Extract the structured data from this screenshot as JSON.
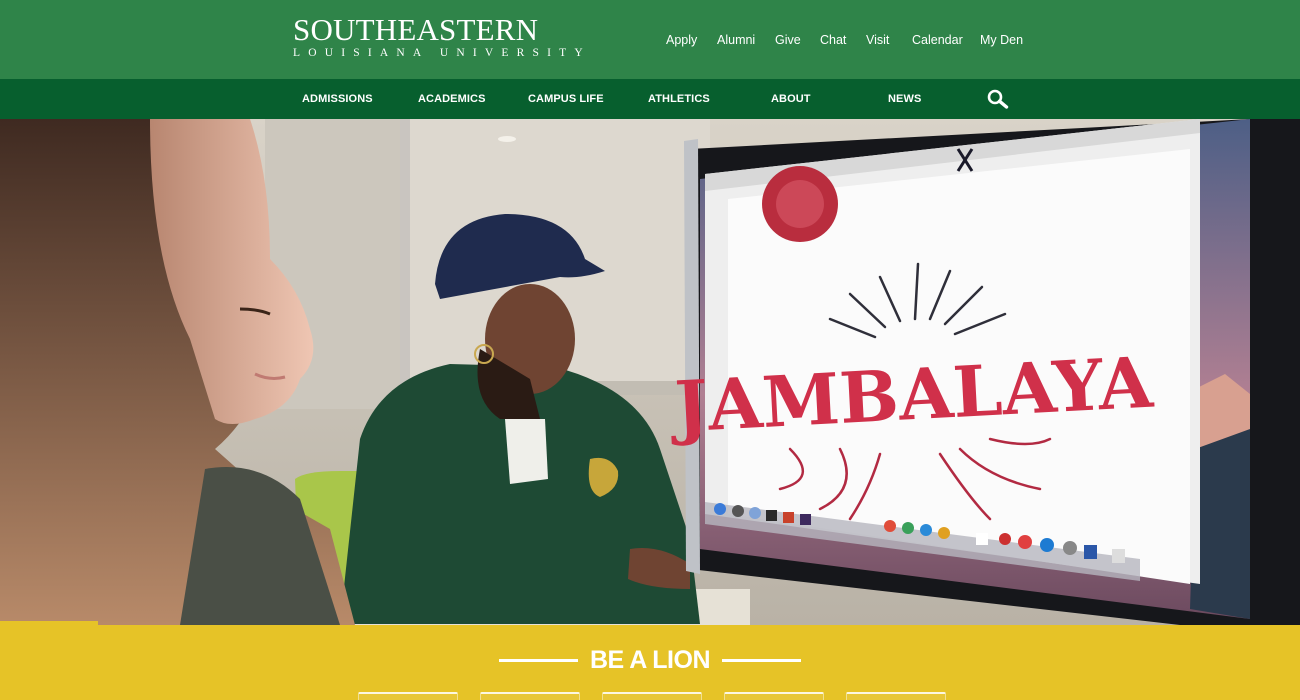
{
  "brand": {
    "name": "SOUTHEASTERN",
    "sub": "LOUISIANA UNIVERSITY"
  },
  "utility_nav": [
    {
      "label": "Apply",
      "name": "apply"
    },
    {
      "label": "Alumni",
      "name": "alumni"
    },
    {
      "label": "Give",
      "name": "give"
    },
    {
      "label": "Chat",
      "name": "chat"
    },
    {
      "label": "Visit",
      "name": "visit"
    },
    {
      "label": "Calendar",
      "name": "calendar"
    },
    {
      "label": "My Den",
      "name": "my-den"
    }
  ],
  "main_nav": [
    {
      "label": "ADMISSIONS",
      "name": "admissions"
    },
    {
      "label": "ACADEMICS",
      "name": "academics"
    },
    {
      "label": "CAMPUS LIFE",
      "name": "campus-life"
    },
    {
      "label": "ATHLETICS",
      "name": "athletics"
    },
    {
      "label": "ABOUT",
      "name": "about"
    },
    {
      "label": "NEWS",
      "name": "news"
    }
  ],
  "hero": {
    "screen_word": "JAMBALAYA"
  },
  "banner": {
    "title": "BE A LION",
    "tab_count": 5
  },
  "icons": {
    "search": "search-icon"
  },
  "colors": {
    "header_green": "#2f8449",
    "nav_green": "#075f2e",
    "banner_gold": "#e6c327",
    "jacket_green": "#1e4a34",
    "jambalaya_red": "#d0304a"
  }
}
